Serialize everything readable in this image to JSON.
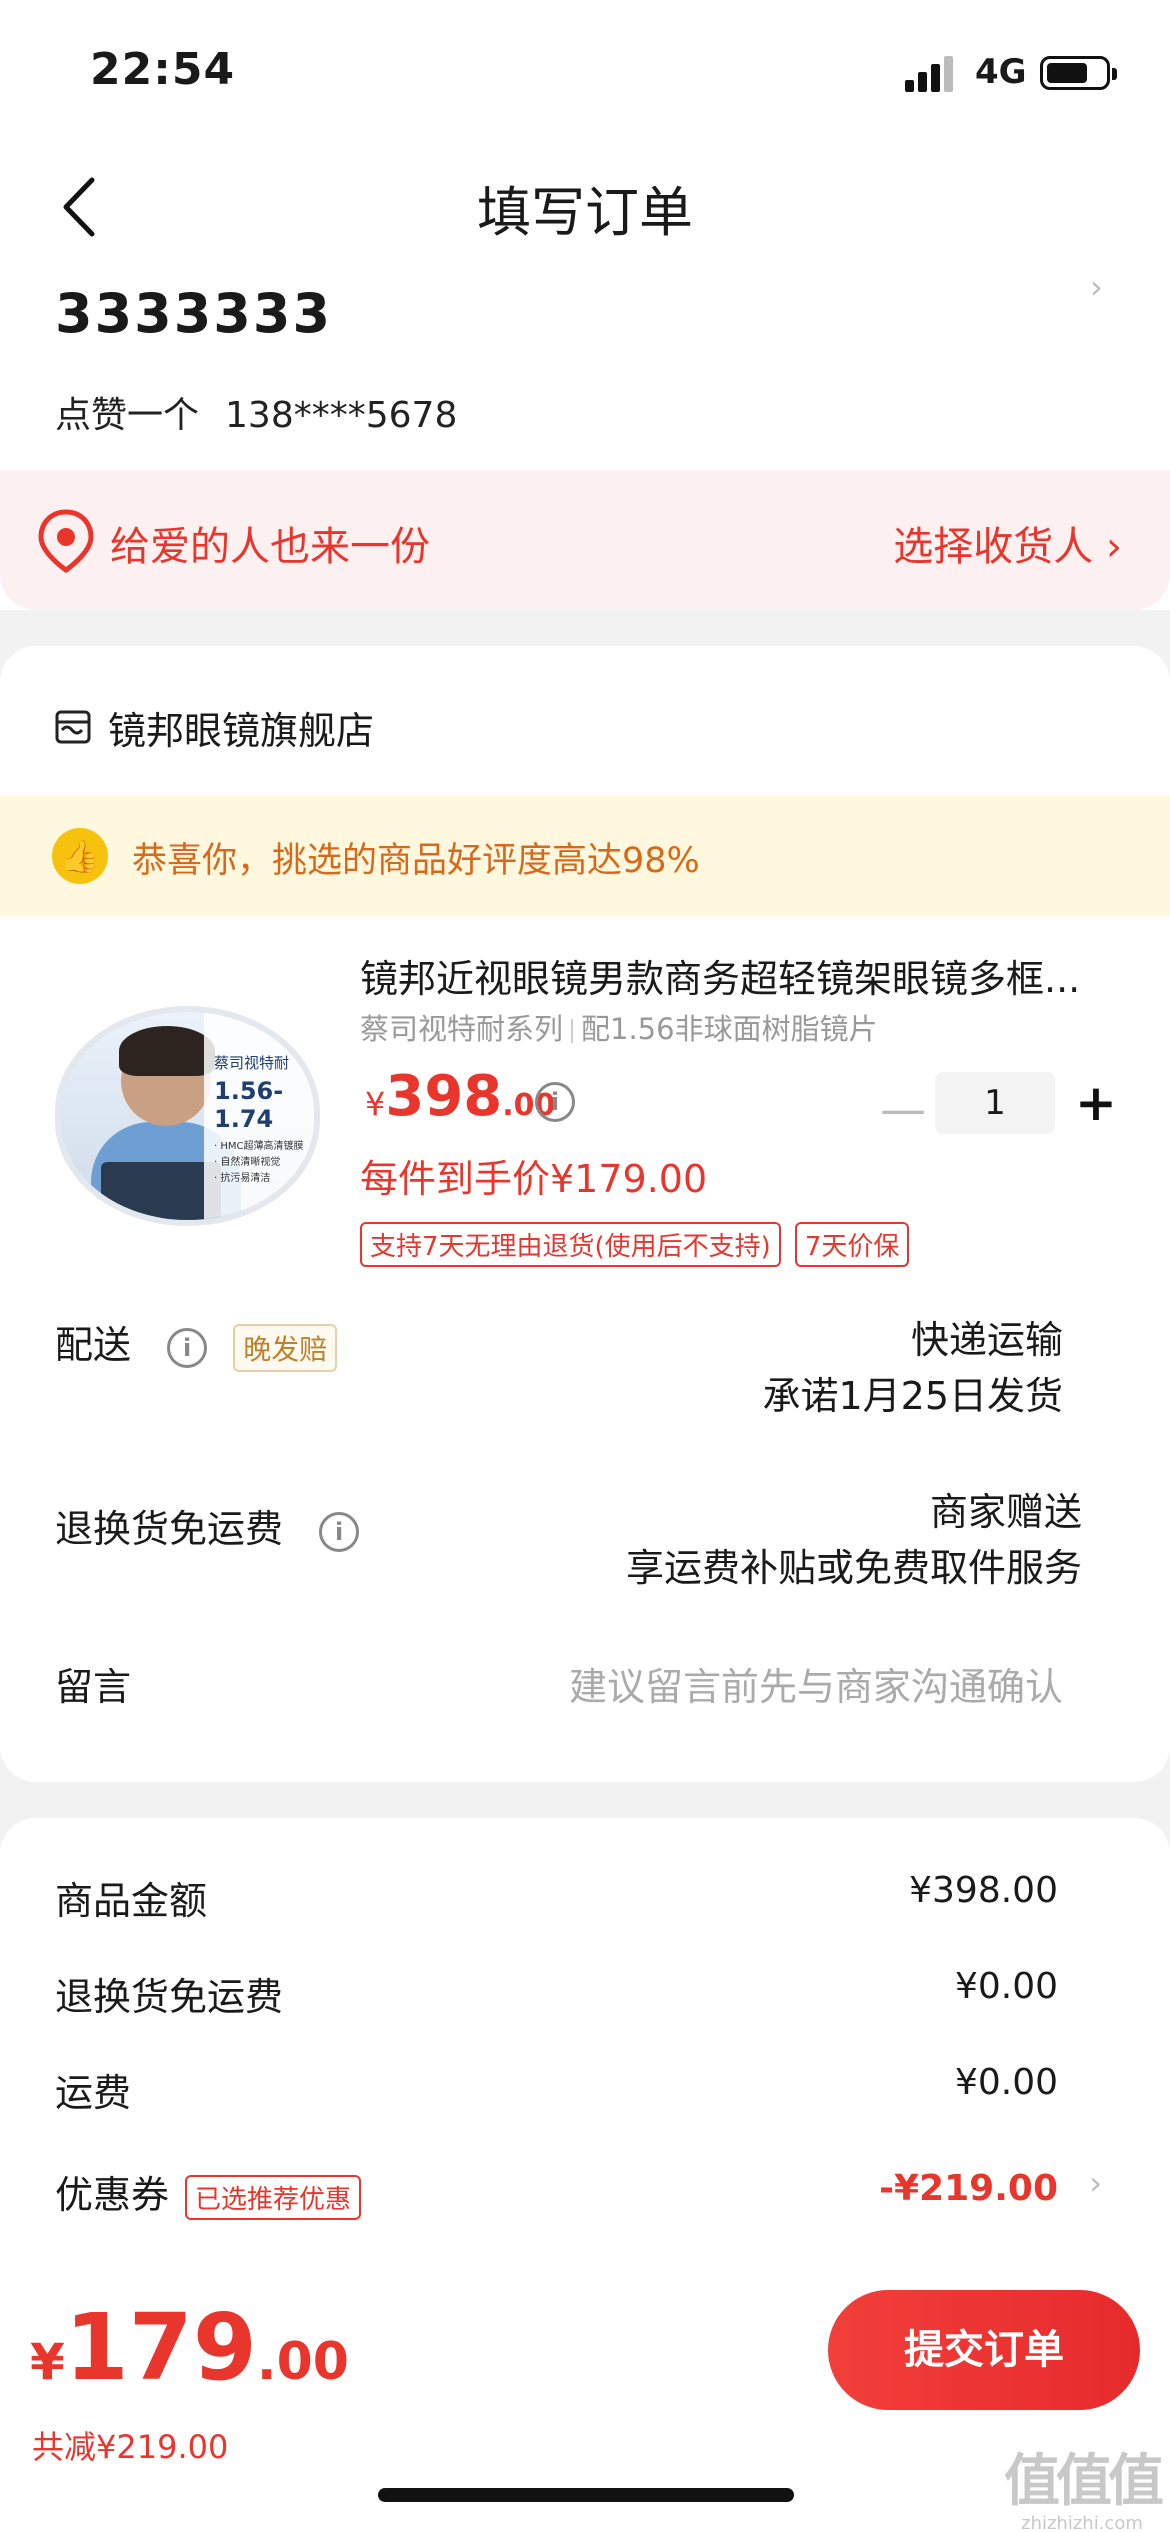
{
  "status_bar": {
    "time": "22:54",
    "network": "4G"
  },
  "nav": {
    "title": "填写订单"
  },
  "address": {
    "name": "3333333",
    "contact_name": "点赞一个",
    "phone": "138****5678"
  },
  "gift": {
    "text": "给爱的人也来一份",
    "link": "选择收货人 ›"
  },
  "store": {
    "name": "镜邦眼镜旗舰店"
  },
  "praise": {
    "text": "恭喜你，挑选的商品好评度高达98%"
  },
  "product": {
    "title": "镜邦近视眼镜男款商务超轻镜架眼镜多框...",
    "spec_series": "蔡司视特耐系列",
    "spec_lens": "配1.56非球面树脂镜片",
    "price_currency": "¥",
    "price_int": "398",
    "price_dec": ".00",
    "quantity": "1",
    "unit_price": "每件到手价¥179.00",
    "tags": [
      "支持7天无理由退货(使用后不支持)",
      "7天价保"
    ],
    "image_panel": {
      "brand": "蔡司视特耐",
      "range": "1.56-1.74",
      "features": [
        "· HMC超薄高清镀膜",
        "· 自然清晰视觉",
        "· 抗污易清洁"
      ]
    }
  },
  "delivery": {
    "label": "配送",
    "late_tag": "晚发赔",
    "method": "快递运输",
    "promise": "承诺1月25日发货"
  },
  "return_shipping": {
    "label": "退换货免运费",
    "value_line1": "商家赠送",
    "value_line2": "享运费补贴或免费取件服务"
  },
  "message": {
    "label": "留言",
    "placeholder": "建议留言前先与商家沟通确认"
  },
  "summary": {
    "goods_label": "商品金额",
    "goods_value": "¥398.00",
    "return_label": "退换货免运费",
    "return_value": "¥0.00",
    "shipping_label": "运费",
    "shipping_value": "¥0.00",
    "coupon_label": "优惠券",
    "coupon_tag": "已选推荐优惠",
    "coupon_value": "-¥219.00"
  },
  "bottom": {
    "total_currency": "¥",
    "total_int": "179",
    "total_dec": ".00",
    "saved": "共减¥219.00",
    "submit": "提交订单"
  },
  "watermark": {
    "line1": "值值值",
    "line2": "zhizhizhi.com"
  },
  "colors": {
    "accent": "#e8362d",
    "praise_bg": "#fff8de",
    "praise_text": "#d7691b",
    "gift_bg": "#fdf0f1"
  }
}
